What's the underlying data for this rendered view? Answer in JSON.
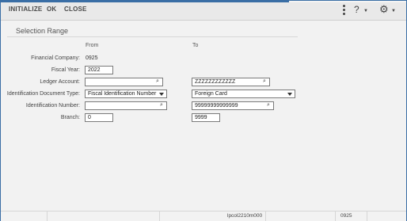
{
  "toolbar": {
    "initialize": "INITIALIZE",
    "ok": "OK",
    "close": "CLOSE",
    "help_icon": "?",
    "settings_icon": "⚙"
  },
  "section": {
    "title": "Selection Range"
  },
  "columns": {
    "from": "From",
    "to": "To"
  },
  "fields": {
    "financial_company": {
      "label": "Financial Company:",
      "value": "0925"
    },
    "fiscal_year": {
      "label": "Fiscal Year:",
      "value": "2022"
    },
    "ledger_account": {
      "label": "Ledger Account:",
      "from": "",
      "to": "ZZZZZZZZZZZZ"
    },
    "id_doc_type": {
      "label": "Identification Document Type:",
      "from": "Fiscal Identification Number",
      "to": "Foreign Card"
    },
    "id_number": {
      "label": "Identification Number:",
      "from": "",
      "to": "99999999999999"
    },
    "branch": {
      "label": "Branch:",
      "from": "0",
      "to": "9999"
    }
  },
  "status": {
    "session": "lpcol2210m000",
    "company": "0925"
  },
  "colors": {
    "accent": "#3a6ea5",
    "background": "#f2f2f2"
  }
}
